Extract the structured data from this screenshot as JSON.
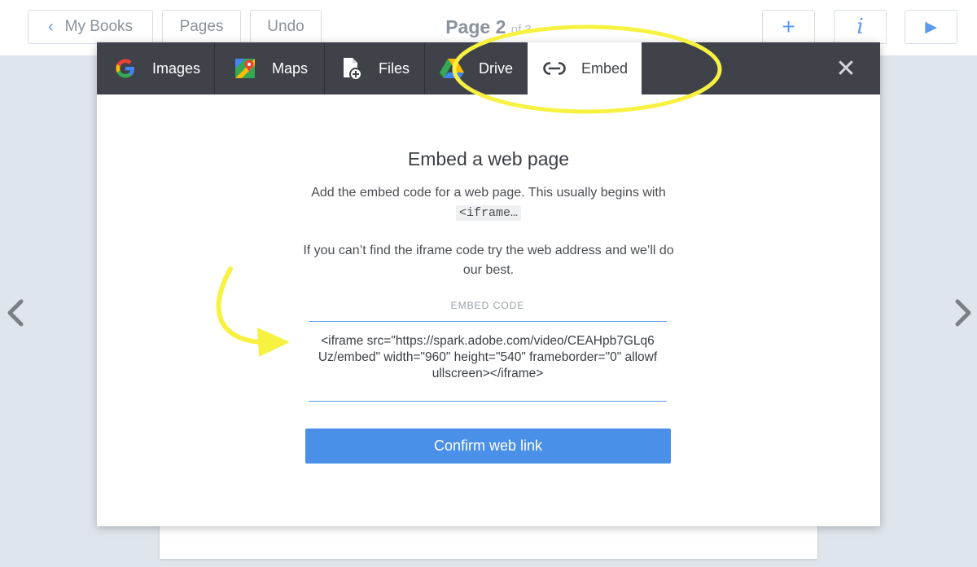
{
  "toolbar": {
    "my_books": "My Books",
    "pages": "Pages",
    "undo": "Undo",
    "page_label": "Page 2",
    "page_of": "of 3",
    "add": "+",
    "info": "i",
    "play": "▶"
  },
  "nav": {
    "prev": "‹",
    "next": "›"
  },
  "modal": {
    "tabs": [
      {
        "label": "Images",
        "icon": "google-icon"
      },
      {
        "label": "Maps",
        "icon": "maps-icon"
      },
      {
        "label": "Files",
        "icon": "file-add-icon"
      },
      {
        "label": "Drive",
        "icon": "drive-icon"
      },
      {
        "label": "Embed",
        "icon": "link-icon"
      }
    ],
    "close": "✕",
    "title": "Embed a web page",
    "description1": "Add the embed code for a web page. This usually begins with",
    "code_hint": "<iframe…",
    "description2": "If you can’t find the iframe code try the web address and we’ll do our best.",
    "field_label": "EMBED CODE",
    "field_value": "<iframe src=\"https://spark.adobe.com/video/CEAHpb7GLq6Uz/embed\"  width=\"960\" height=\"540\" frameborder=\"0\" allowfullscreen></iframe>",
    "confirm_label": "Confirm web link"
  },
  "colors": {
    "accent": "#4a8fe8",
    "tabbar": "#404249",
    "highlight": "#f7f242"
  }
}
